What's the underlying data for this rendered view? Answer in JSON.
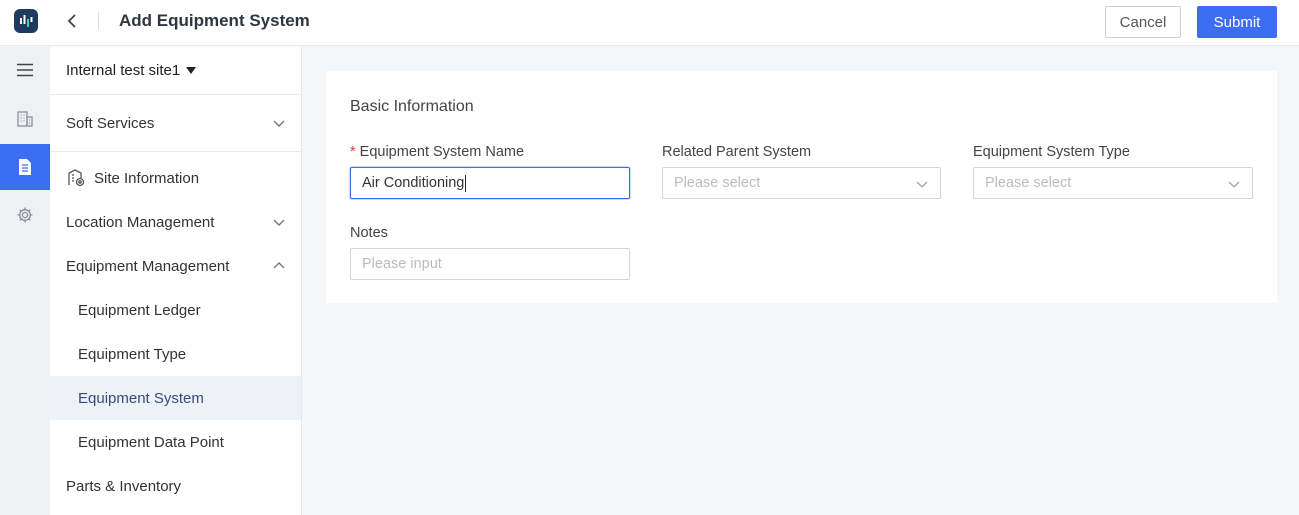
{
  "header": {
    "title": "Add Equipment System",
    "cancel_label": "Cancel",
    "submit_label": "Submit"
  },
  "sidebar": {
    "site_name": "Internal test site1",
    "items": [
      {
        "label": "Soft Services"
      },
      {
        "label": "Site Information"
      },
      {
        "label": "Location Management"
      },
      {
        "label": "Equipment Management"
      },
      {
        "label": "Equipment Ledger"
      },
      {
        "label": "Equipment Type"
      },
      {
        "label": "Equipment System"
      },
      {
        "label": "Equipment Data Point"
      },
      {
        "label": "Parts & Inventory"
      }
    ]
  },
  "form": {
    "section_title": "Basic Information",
    "required_mark": "*",
    "name_label": "Equipment System Name",
    "name_value": "Air Conditioning",
    "parent_label": "Related Parent System",
    "parent_placeholder": "Please select",
    "type_label": "Equipment System Type",
    "type_placeholder": "Please select",
    "notes_label": "Notes",
    "notes_placeholder": "Please input"
  },
  "colors": {
    "accent": "#3d6df2",
    "selected_nav_bg": "#eef1f8",
    "required": "#e03a3a"
  }
}
